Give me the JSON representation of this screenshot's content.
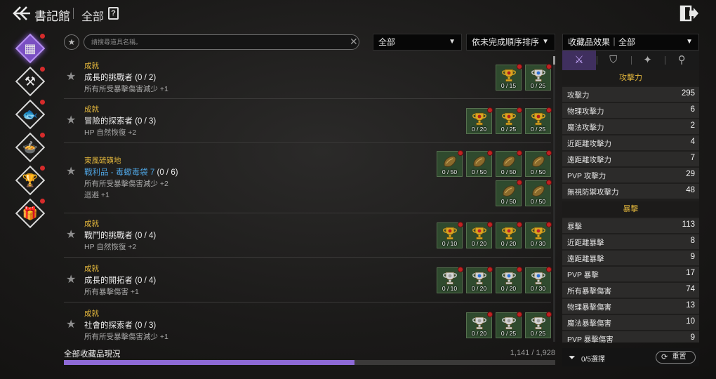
{
  "header": {
    "title": "書記館",
    "subtitle": "全部"
  },
  "sidebar": {
    "items": [
      {
        "name": "all-collections",
        "glyph": "▦",
        "active": true,
        "notify": true
      },
      {
        "name": "equipment",
        "glyph": "⚒",
        "active": false,
        "notify": true
      },
      {
        "name": "fishing",
        "glyph": "🐟",
        "active": false,
        "notify": true
      },
      {
        "name": "cooking",
        "glyph": "🍲",
        "active": false,
        "notify": true
      },
      {
        "name": "trophy",
        "glyph": "🏆",
        "active": false,
        "notify": true
      },
      {
        "name": "gift",
        "glyph": "🎁",
        "active": false,
        "notify": true
      }
    ]
  },
  "search": {
    "placeholder": "請搜尋道具名稱。"
  },
  "filters": {
    "category": "全部",
    "sort": "依未完成順序排序"
  },
  "entries": [
    {
      "category": "成就",
      "name": "成長的挑戰者",
      "progress": "(0 / 2)",
      "effects": [
        "所有所受暴擊傷害減少 +1"
      ],
      "slots": [
        {
          "item": "trophy-gold",
          "count": "0 / 15"
        },
        {
          "item": "trophy-blue",
          "count": "0 / 25"
        }
      ]
    },
    {
      "category": "成就",
      "name": "冒險的探索者",
      "progress": "(0 / 3)",
      "effects": [
        "HP 自然恢復 +2"
      ],
      "slots": [
        {
          "item": "trophy-gold",
          "count": "0 / 20"
        },
        {
          "item": "trophy-gold",
          "count": "0 / 25"
        },
        {
          "item": "trophy-gold",
          "count": "0 / 25"
        }
      ]
    },
    {
      "category": "東風硫磺地",
      "name": "戰利品 - 毒蠍毒袋 7",
      "progress": "(0 / 6)",
      "link": true,
      "effects": [
        "所有所受暴擊傷害減少 +2",
        "迴避 +1"
      ],
      "slots": [
        {
          "item": "poison-sac",
          "count": "0 / 50"
        },
        {
          "item": "poison-sac",
          "count": "0 / 50"
        },
        {
          "item": "poison-sac",
          "count": "0 / 50"
        },
        {
          "item": "poison-sac",
          "count": "0 / 50"
        },
        {
          "item": "poison-sac",
          "count": "0 / 50"
        },
        {
          "item": "poison-sac",
          "count": "0 / 50"
        }
      ]
    },
    {
      "category": "成就",
      "name": "戰鬥的挑戰者",
      "progress": "(0 / 4)",
      "effects": [
        "HP 自然恢復 +2"
      ],
      "slots": [
        {
          "item": "trophy-gold",
          "count": "0 / 10"
        },
        {
          "item": "trophy-red",
          "count": "0 / 20"
        },
        {
          "item": "trophy-red",
          "count": "0 / 20"
        },
        {
          "item": "trophy-red",
          "count": "0 / 30"
        }
      ]
    },
    {
      "category": "成就",
      "name": "成長的開拓者",
      "progress": "(0 / 4)",
      "effects": [
        "所有暴擊傷害 +1"
      ],
      "slots": [
        {
          "item": "trophy-silver",
          "count": "0 / 10"
        },
        {
          "item": "trophy-blue",
          "count": "0 / 20"
        },
        {
          "item": "trophy-blue",
          "count": "0 / 20"
        },
        {
          "item": "trophy-blue",
          "count": "0 / 30"
        }
      ]
    },
    {
      "category": "成就",
      "name": "社會的探索者",
      "progress": "(0 / 3)",
      "effects": [
        "所有所受暴擊傷害減少 +1"
      ],
      "slots": [
        {
          "item": "trophy-silver",
          "count": "0 / 20"
        },
        {
          "item": "trophy-silver",
          "count": "0 / 25"
        },
        {
          "item": "trophy-silver",
          "count": "0 / 25"
        }
      ]
    }
  ],
  "footer": {
    "label": "全部收藏品現況",
    "count": "1,141 / 1,928",
    "progress": 0.592
  },
  "panel": {
    "dropdown": "收藏品效果｜全部",
    "tabs": [
      {
        "name": "attack",
        "glyph": "⚔",
        "active": true
      },
      {
        "name": "defense",
        "glyph": "⛉",
        "active": false
      },
      {
        "name": "misc",
        "glyph": "✦",
        "active": false
      },
      {
        "name": "search",
        "glyph": "⚲",
        "active": false
      }
    ],
    "sections": [
      {
        "title": "攻擊力",
        "rows": [
          {
            "label": "攻擊力",
            "value": "295"
          },
          {
            "label": "物理攻擊力",
            "value": "6"
          },
          {
            "label": "魔法攻擊力",
            "value": "2"
          },
          {
            "label": "近距離攻擊力",
            "value": "4"
          },
          {
            "label": "遠距離攻擊力",
            "value": "7"
          },
          {
            "label": "PVP 攻擊力",
            "value": "29"
          },
          {
            "label": "無視防禦攻擊力",
            "value": "48"
          }
        ]
      },
      {
        "title": "暴擊",
        "rows": [
          {
            "label": "暴擊",
            "value": "113"
          },
          {
            "label": "近距離暴擊",
            "value": "8"
          },
          {
            "label": "遠距離暴擊",
            "value": "9"
          },
          {
            "label": "PVP 暴擊",
            "value": "17"
          },
          {
            "label": "所有暴擊傷害",
            "value": "74"
          },
          {
            "label": "物理暴擊傷害",
            "value": "13"
          },
          {
            "label": "魔法暴擊傷害",
            "value": "10"
          },
          {
            "label": "PVP 暴擊傷害",
            "value": "9"
          }
        ]
      }
    ],
    "filter_label": "0/5選擇",
    "reset_label": "重置"
  },
  "colors": {
    "accent_purple": "#8e6ad6",
    "section_gold": "#e2b63c",
    "link_blue": "#4ea3e0",
    "slot_green": "#2f4a2e",
    "notify_red": "#d62b2b"
  }
}
